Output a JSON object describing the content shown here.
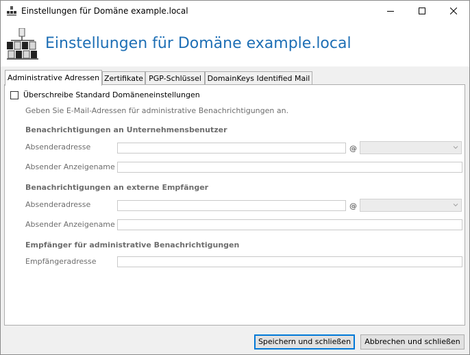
{
  "window": {
    "title": "Einstellungen für Domäne example.local",
    "min_icon": "minimize-icon",
    "max_icon": "maximize-icon",
    "close_icon": "close-icon"
  },
  "header": {
    "title": "Einstellungen für Domäne example.local",
    "title_color": "#1e6fb5",
    "icon": "network-icon"
  },
  "tabs": [
    {
      "label": "Administrative Adressen",
      "active": true
    },
    {
      "label": "Zertifikate",
      "active": false
    },
    {
      "label": "PGP-Schlüssel",
      "active": false
    },
    {
      "label": "DomainKeys Identified Mail",
      "active": false
    }
  ],
  "override": {
    "label": "Überschreibe Standard Domäneneinstellungen",
    "checked": false
  },
  "description": "Geben Sie E-Mail-Adressen für administrative Benachrichtigungen an.",
  "sections": {
    "internal": {
      "heading": "Benachrichtigungen an Unternehmensbenutzer",
      "sender_label": "Absenderadresse",
      "sender_value": "",
      "at_sign": "@",
      "domain_value": "",
      "display_label": "Absender Anzeigename",
      "display_value": ""
    },
    "external": {
      "heading": "Benachrichtigungen an externe Empfänger",
      "sender_label": "Absenderadresse",
      "sender_value": "",
      "at_sign": "@",
      "domain_value": "",
      "display_label": "Absender Anzeigename",
      "display_value": ""
    },
    "admin": {
      "heading": "Empfänger für administrative Benachrichtigungen",
      "recipient_label": "Empfängeradresse",
      "recipient_value": ""
    }
  },
  "buttons": {
    "save": "Speichern und schließen",
    "cancel": "Abbrechen und schließen"
  },
  "colors": {
    "accent": "#0078d7",
    "disabled_text": "#6d6d6d"
  }
}
